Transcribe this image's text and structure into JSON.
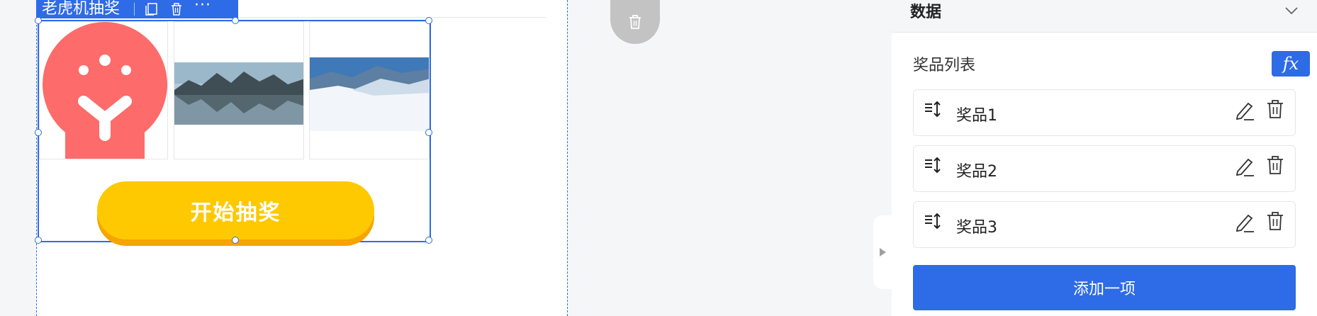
{
  "component": {
    "title": "老虎机抽奖",
    "start_button": "开始抽奖"
  },
  "panel": {
    "section_title": "数据",
    "list_label": "奖品列表",
    "fx_label": "fx",
    "items": [
      {
        "name": "奖品1"
      },
      {
        "name": "奖品2"
      },
      {
        "name": "奖品3"
      }
    ],
    "add_button": "添加一项"
  },
  "colors": {
    "accent": "#2e6be6",
    "button_yellow": "#fec900",
    "button_shadow": "#f5a400",
    "logo_red": "#fd6b6b"
  }
}
